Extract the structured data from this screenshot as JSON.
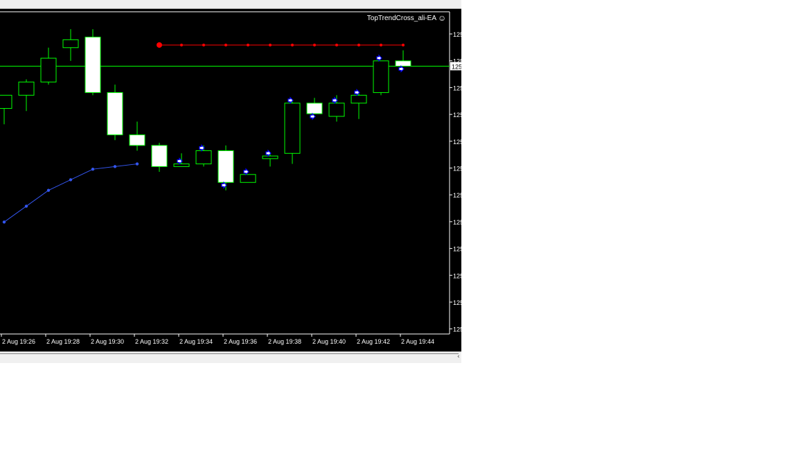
{
  "window": {
    "ea_label": "TopTrendCross_ali-EA",
    "smiley_glyph": "☺",
    "scroll_right_glyph": "‹"
  },
  "price_scale": {
    "labels": [
      "125",
      "125",
      "125",
      "125",
      "125",
      "125",
      "125",
      "125",
      "125",
      "125",
      "125",
      "125"
    ],
    "current_price_label": "125"
  },
  "time_axis": {
    "labels": [
      "2 Aug 19:26",
      "2 Aug 19:28",
      "2 Aug 19:30",
      "2 Aug 19:32",
      "2 Aug 19:34",
      "2 Aug 19:36",
      "2 Aug 19:38",
      "2 Aug 19:40",
      "2 Aug 19:42",
      "2 Aug 19:44"
    ]
  },
  "colors": {
    "background": "#000000",
    "candle_outline": "#00ff00",
    "bull_body": "#000000",
    "bear_body": "#ffffff",
    "blue_line": "#3355ee",
    "red_line": "#ff0000",
    "price_line": "#00ff00",
    "arrow_fill": "#ffffff",
    "arrow_stroke": "#0000ff",
    "frame": "#ffffff",
    "text": "#ffffff"
  },
  "chart_data": {
    "type": "candlestick",
    "x_start": "2 Aug 19:25",
    "x_step_minutes": 1,
    "price_unit": "relative",
    "y_range": [
      0.0,
      11.8
    ],
    "candles": [
      {
        "o": 8.3,
        "h": 8.6,
        "l": 7.7,
        "c": 8.8
      },
      {
        "o": 8.8,
        "h": 9.4,
        "l": 8.2,
        "c": 9.3
      },
      {
        "o": 9.3,
        "h": 10.6,
        "l": 9.2,
        "c": 10.2
      },
      {
        "o": 10.6,
        "h": 11.3,
        "l": 10.1,
        "c": 10.9
      },
      {
        "o": 11.0,
        "h": 11.3,
        "l": 8.8,
        "c": 8.9
      },
      {
        "o": 8.9,
        "h": 9.2,
        "l": 7.1,
        "c": 7.3
      },
      {
        "o": 7.3,
        "h": 7.8,
        "l": 6.7,
        "c": 6.9
      },
      {
        "o": 6.9,
        "h": 7.0,
        "l": 5.9,
        "c": 6.1
      },
      {
        "o": 6.1,
        "h": 6.6,
        "l": 6.1,
        "c": 6.2
      },
      {
        "o": 6.2,
        "h": 6.9,
        "l": 6.1,
        "c": 6.7
      },
      {
        "o": 6.7,
        "h": 6.9,
        "l": 5.2,
        "c": 5.5
      },
      {
        "o": 5.5,
        "h": 5.8,
        "l": 5.5,
        "c": 5.8
      },
      {
        "o": 6.4,
        "h": 6.6,
        "l": 6.1,
        "c": 6.5
      },
      {
        "o": 6.6,
        "h": 8.6,
        "l": 6.2,
        "c": 8.5
      },
      {
        "o": 8.5,
        "h": 8.7,
        "l": 8.1,
        "c": 8.1
      },
      {
        "o": 8.0,
        "h": 8.8,
        "l": 7.8,
        "c": 8.5
      },
      {
        "o": 8.5,
        "h": 8.9,
        "l": 7.9,
        "c": 8.8
      },
      {
        "o": 8.9,
        "h": 9.6,
        "l": 8.8,
        "c": 10.1
      },
      {
        "o": 10.1,
        "h": 10.5,
        "l": 9.9,
        "c": 9.9
      }
    ],
    "blue_line": [
      4.0,
      4.6,
      5.2,
      5.6,
      6.0,
      6.1,
      6.2
    ],
    "red_line": {
      "level": 10.7,
      "from_index": 7,
      "to_index": 18
    },
    "current_price": 9.9,
    "arrows_from_index": 8
  }
}
